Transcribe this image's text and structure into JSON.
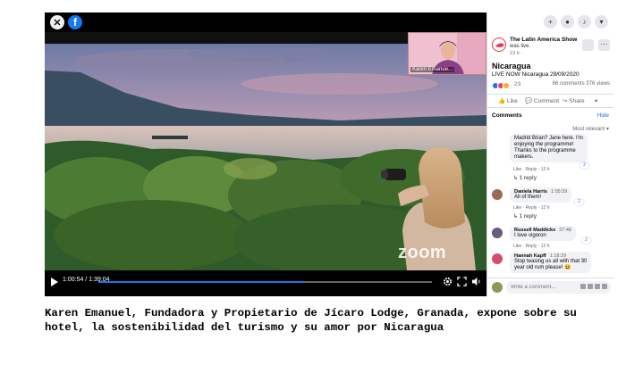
{
  "video": {
    "pip_label": "Karen Emanue...",
    "watermark": "zoom",
    "time": "1:00:54 / 1:39:04",
    "progress": 0.615
  },
  "panel": {
    "page_name": "The Latin America Show",
    "page_sub": "was live.",
    "page_time": "13 h · ",
    "post_title": "Nicaragua",
    "post_desc": "LIVE NOW Nicaragua 29/09/2020",
    "reaction_count": "23",
    "stats": "66 comments  376 views",
    "actions": {
      "like": "Like",
      "comment": "Comment",
      "share": "Share"
    },
    "comments_header": "Comments",
    "hide": "Hide",
    "sort": "Most relevant",
    "write_placeholder": "Write a comment..."
  },
  "comments": [
    {
      "name": "",
      "time": "",
      "text": [
        "Madrid Brian? Jane here. I'm",
        "enjoying the programme!",
        "Thanks to the programme",
        "makers."
      ],
      "actions": "Like · Reply · 12 h",
      "likes": "2",
      "replies": "1 reply",
      "avatar_color": ""
    },
    {
      "name": "Daniela Harris",
      "time": "1:05:59",
      "text": [
        "All of them!"
      ],
      "actions": "Like · Reply · 12 h",
      "likes": "2",
      "replies": "1 reply",
      "avatar_color": "#9c6b58"
    },
    {
      "name": "Russell Maddicks",
      "time": "37:48",
      "text": [
        "I love vigoron"
      ],
      "actions": "Like · Reply · 12 h",
      "likes": "2",
      "replies": "",
      "avatar_color": "#6a5a7c"
    },
    {
      "name": "Hannah Kapff",
      "time": "1:18:29",
      "text": [
        "Stop teasing us all with that 30",
        "year old rum please! 😆"
      ],
      "actions": "",
      "likes": "",
      "replies": "",
      "avatar_color": "#d44d6c"
    }
  ],
  "caption": "Karen Emanuel, Fundadora y Propietario de Jícaro Lodge, Granada, expone sobre su hotel, la sostenibilidad del turismo y su amor por Nicaragua",
  "colors": {
    "facebook_blue": "#1877f2",
    "panel_gray": "#f0f2f5"
  },
  "icons": [
    "close-icon",
    "facebook-icon",
    "play-icon",
    "settings-icon",
    "fullscreen-icon",
    "volume-icon",
    "plus-icon",
    "messenger-icon",
    "bell-icon",
    "chevron-down-icon"
  ]
}
